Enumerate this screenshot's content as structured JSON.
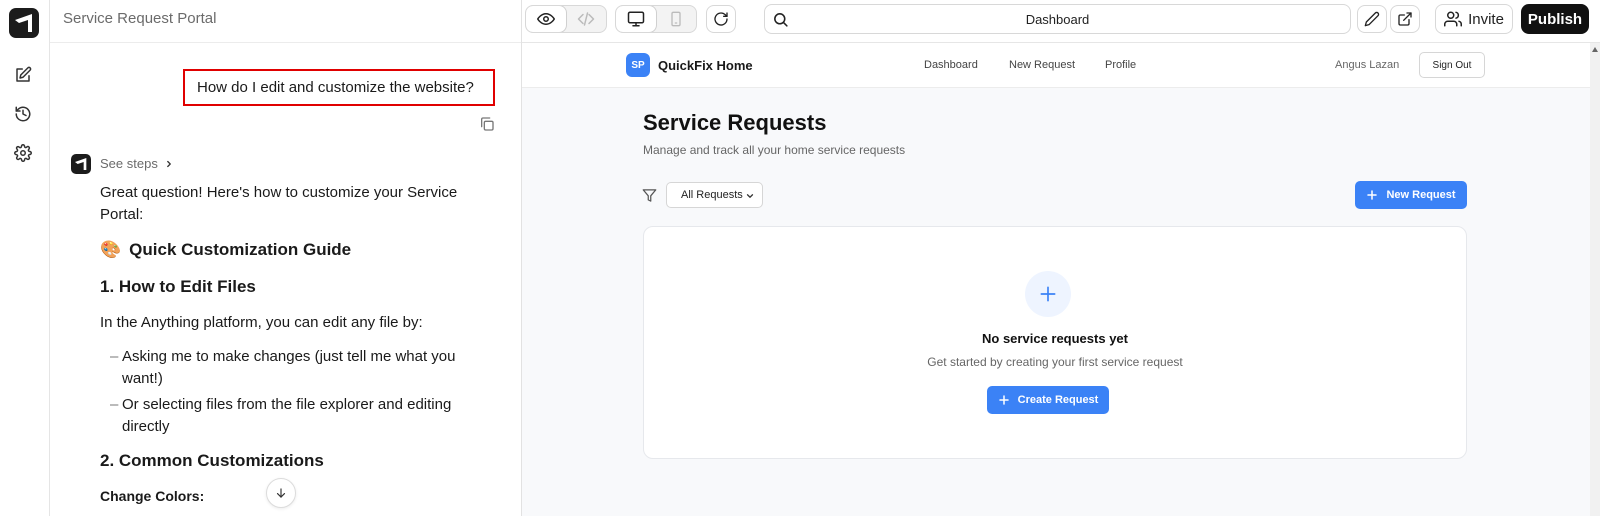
{
  "chat": {
    "title": "Service Request Portal",
    "user_message": "How do I edit and customize the website?",
    "see_steps": "See steps",
    "response": {
      "intro": "Great question! Here's how to customize your Service Portal:",
      "guide_emoji": "🎨",
      "guide_heading": "Quick Customization Guide",
      "section1_heading": "1. How to Edit Files",
      "section1_text": "In the Anything platform, you can edit any file by:",
      "bullets": [
        "Asking me to make changes (just tell me what you want!)",
        "Or selecting files from the file explorer and editing directly"
      ],
      "section2_heading": "2. Common Customizations",
      "change_colors_label": "Change Colors:"
    }
  },
  "toolbar": {
    "url": "Dashboard",
    "invite_label": "Invite",
    "publish_label": "Publish"
  },
  "app": {
    "brand_badge": "SP",
    "brand_name": "QuickFix Home",
    "nav_links": [
      "Dashboard",
      "New Request",
      "Profile"
    ],
    "user_name": "Angus Lazan",
    "sign_out_label": "Sign Out",
    "page_title": "Service Requests",
    "page_subtitle": "Manage and track all your home service requests",
    "filter_value": "All Requests",
    "new_request_label": "New Request",
    "empty_title": "No service requests yet",
    "empty_subtitle": "Get started by creating your first service request",
    "create_request_label": "Create Request"
  },
  "colors": {
    "accent_blue": "#3b82f6",
    "highlight_red": "#e00000",
    "publish_black": "#111111"
  },
  "icons": {
    "rail": [
      "app-logo-icon",
      "edit-icon",
      "history-icon",
      "gear-icon"
    ],
    "toolbar": [
      "eye-icon",
      "code-icon",
      "desktop-icon",
      "mobile-icon",
      "refresh-icon",
      "search-icon",
      "pencil-icon",
      "external-link-icon",
      "users-icon"
    ],
    "chat": [
      "copy-icon",
      "chevron-right-icon",
      "arrow-down-icon"
    ],
    "app": [
      "filter-icon",
      "plus-icon",
      "chevron-down-icon"
    ]
  }
}
